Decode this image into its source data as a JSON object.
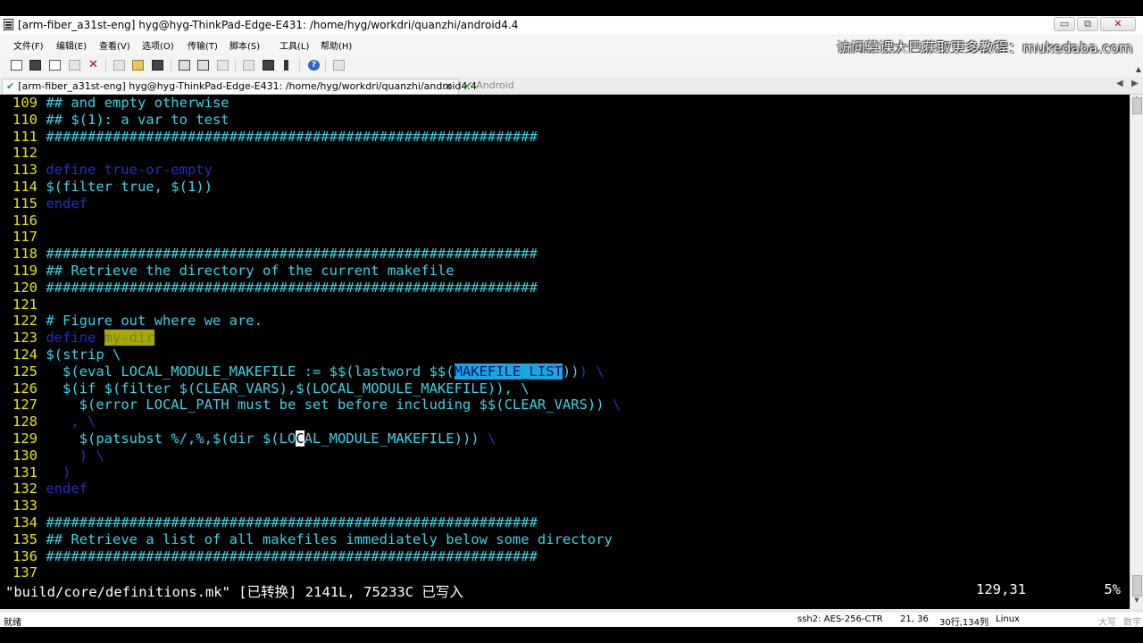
{
  "window": {
    "title": "[arm-fiber_a31st-eng] hyg@hyg-ThinkPad-Edge-E431: /home/hyg/workdri/quanzhi/android4.4",
    "minimize": "▭",
    "maximize": "⧉",
    "close": "✕"
  },
  "menu": [
    "文件(F)",
    "编辑(E)",
    "查看(V)",
    "选项(O)",
    "传输(T)",
    "脚本(S)",
    "工具(L)",
    "帮助(H)"
  ],
  "watermark": "访问慕课大巴获取更多教程：mukedaba.com",
  "tabs": {
    "active": "[arm-fiber_a31st-eng] hyg@hyg-ThinkPad-Edge-E431: /home/hyg/workdri/quanzhi/android4.4",
    "active_close": "✕",
    "inactive": "Android",
    "nav_left": "◀",
    "nav_right": "▶"
  },
  "terminal": {
    "lines": [
      [
        {
          "t": "109 ",
          "c": "ln"
        },
        {
          "t": "## and empty otherwise",
          "c": "c-cyan"
        }
      ],
      [
        {
          "t": "110 ",
          "c": "ln"
        },
        {
          "t": "## $(1): a var to test",
          "c": "c-cyan"
        }
      ],
      [
        {
          "t": "111 ",
          "c": "ln"
        },
        {
          "t": "###########################################################",
          "c": "c-cyan"
        }
      ],
      [
        {
          "t": "112",
          "c": "ln"
        }
      ],
      [
        {
          "t": "113 ",
          "c": "ln"
        },
        {
          "t": "define true-or-empty",
          "c": "c-blue"
        }
      ],
      [
        {
          "t": "114 ",
          "c": "ln"
        },
        {
          "t": "$(filter true, $(1))",
          "c": "c-cyan"
        }
      ],
      [
        {
          "t": "115 ",
          "c": "ln"
        },
        {
          "t": "endef",
          "c": "c-blue"
        }
      ],
      [
        {
          "t": "116",
          "c": "ln"
        }
      ],
      [
        {
          "t": "117",
          "c": "ln"
        }
      ],
      [
        {
          "t": "118 ",
          "c": "ln"
        },
        {
          "t": "###########################################################",
          "c": "c-cyan"
        }
      ],
      [
        {
          "t": "119 ",
          "c": "ln"
        },
        {
          "t": "## Retrieve the directory of the current makefile",
          "c": "c-cyan"
        }
      ],
      [
        {
          "t": "120 ",
          "c": "ln"
        },
        {
          "t": "###########################################################",
          "c": "c-cyan"
        }
      ],
      [
        {
          "t": "121",
          "c": "ln"
        }
      ],
      [
        {
          "t": "122 ",
          "c": "ln"
        },
        {
          "t": "# Figure out where we are.",
          "c": "c-cyan"
        }
      ],
      [
        {
          "t": "123 ",
          "c": "ln"
        },
        {
          "t": "define ",
          "c": "c-blue"
        },
        {
          "t": "my-dir",
          "c": "hl-yellow"
        }
      ],
      [
        {
          "t": "124 ",
          "c": "ln"
        },
        {
          "t": "$(strip \\",
          "c": "c-cyan"
        }
      ],
      [
        {
          "t": "125 ",
          "c": "ln"
        },
        {
          "t": "  $(eval LOCAL_MODULE_MAKEFILE := $$(lastword $$(",
          "c": "c-cyan"
        },
        {
          "t": "MAKEFILE_LIST",
          "c": "hl-sel"
        },
        {
          "t": "))",
          "c": "c-cyan"
        },
        {
          "t": ") \\",
          "c": "c-blue"
        }
      ],
      [
        {
          "t": "126 ",
          "c": "ln"
        },
        {
          "t": "  $(if $(filter $(CLEAR_VARS),$(LOCAL_MODULE_MAKEFILE)), \\",
          "c": "c-cyan"
        }
      ],
      [
        {
          "t": "127 ",
          "c": "ln"
        },
        {
          "t": "    $(error LOCAL_PATH must be set before including $$(CLEAR_VARS))",
          "c": "c-cyan"
        },
        {
          "t": " \\",
          "c": "c-blue"
        }
      ],
      [
        {
          "t": "128 ",
          "c": "ln"
        },
        {
          "t": "   , \\",
          "c": "c-blue"
        }
      ],
      [
        {
          "t": "129 ",
          "c": "ln"
        },
        {
          "t": "    $(patsubst %/,%,$(dir $(LO",
          "c": "c-cyan"
        },
        {
          "t": "C",
          "c": "cursor"
        },
        {
          "t": "AL_MODULE_MAKEFILE)))",
          "c": "c-cyan"
        },
        {
          "t": " \\",
          "c": "c-blue"
        }
      ],
      [
        {
          "t": "130 ",
          "c": "ln"
        },
        {
          "t": "    ) \\",
          "c": "c-blue"
        }
      ],
      [
        {
          "t": "131 ",
          "c": "ln"
        },
        {
          "t": "  )",
          "c": "c-blue"
        }
      ],
      [
        {
          "t": "132 ",
          "c": "ln"
        },
        {
          "t": "endef",
          "c": "c-blue"
        }
      ],
      [
        {
          "t": "133",
          "c": "ln"
        }
      ],
      [
        {
          "t": "134 ",
          "c": "ln"
        },
        {
          "t": "###########################################################",
          "c": "c-cyan"
        }
      ],
      [
        {
          "t": "135 ",
          "c": "ln"
        },
        {
          "t": "## Retrieve a list of all makefiles immediately below some directory",
          "c": "c-cyan"
        }
      ],
      [
        {
          "t": "136 ",
          "c": "ln"
        },
        {
          "t": "###########################################################",
          "c": "c-cyan"
        }
      ],
      [
        {
          "t": "137",
          "c": "ln"
        }
      ]
    ],
    "status_msg": "\"build/core/definitions.mk\" [已转换] 2141L, 75233C 已写入",
    "status_pos": "129,31",
    "status_pct": "5%"
  },
  "statusbar": {
    "ready": "就绪",
    "session": "ssh2: AES-256-CTR",
    "cursor": "21, 36",
    "size": "30行,134列",
    "os": "Linux",
    "caps": "大写",
    "num": "数字"
  },
  "colors": {
    "terminal_bg": "#000000",
    "line_number": "#e6e600",
    "text_cyan": "#3ad3e6",
    "keyword_blue": "#2030c8",
    "selection": "#1aa7e0",
    "search_highlight": "#a8a800"
  }
}
